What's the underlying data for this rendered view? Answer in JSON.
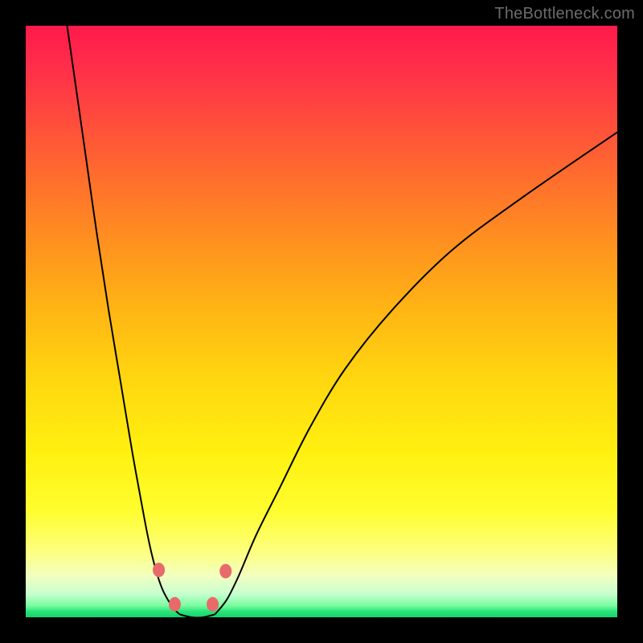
{
  "watermark": {
    "text": "TheBottleneck.com"
  },
  "chart_data": {
    "type": "line",
    "title": "",
    "xlabel": "",
    "ylabel": "",
    "xlim": [
      0,
      100
    ],
    "ylim": [
      0,
      100
    ],
    "grid": false,
    "legend": false,
    "series": [
      {
        "name": "left-curve",
        "x": [
          7,
          8,
          9,
          10,
          12,
          14,
          16,
          18,
          20,
          21,
          22,
          23,
          24,
          25,
          26
        ],
        "values": [
          100,
          93,
          86,
          79,
          65,
          52,
          40,
          28,
          17,
          12,
          8,
          5,
          3,
          1.5,
          0.5
        ]
      },
      {
        "name": "valley-floor",
        "x": [
          26,
          28,
          30,
          32
        ],
        "values": [
          0.5,
          0,
          0,
          0.5
        ]
      },
      {
        "name": "right-curve",
        "x": [
          32,
          34,
          36,
          39,
          43,
          48,
          54,
          62,
          72,
          84,
          100
        ],
        "values": [
          0.5,
          3,
          7,
          14,
          22,
          32,
          42,
          52,
          62,
          71,
          82
        ]
      }
    ],
    "markers": [
      {
        "name": "left-dot-upper",
        "x": 22.5,
        "y": 8
      },
      {
        "name": "left-dot-lower",
        "x": 25.2,
        "y": 2.2
      },
      {
        "name": "right-dot-lower",
        "x": 31.6,
        "y": 2.2
      },
      {
        "name": "right-dot-upper",
        "x": 33.8,
        "y": 7.8
      }
    ],
    "gradient_stops": [
      {
        "pos": 0,
        "color": "#ff1a4b"
      },
      {
        "pos": 25,
        "color": "#ff6b2e"
      },
      {
        "pos": 60,
        "color": "#ffd70f"
      },
      {
        "pos": 82,
        "color": "#fffd2e"
      },
      {
        "pos": 100,
        "color": "#16d26b"
      }
    ]
  }
}
